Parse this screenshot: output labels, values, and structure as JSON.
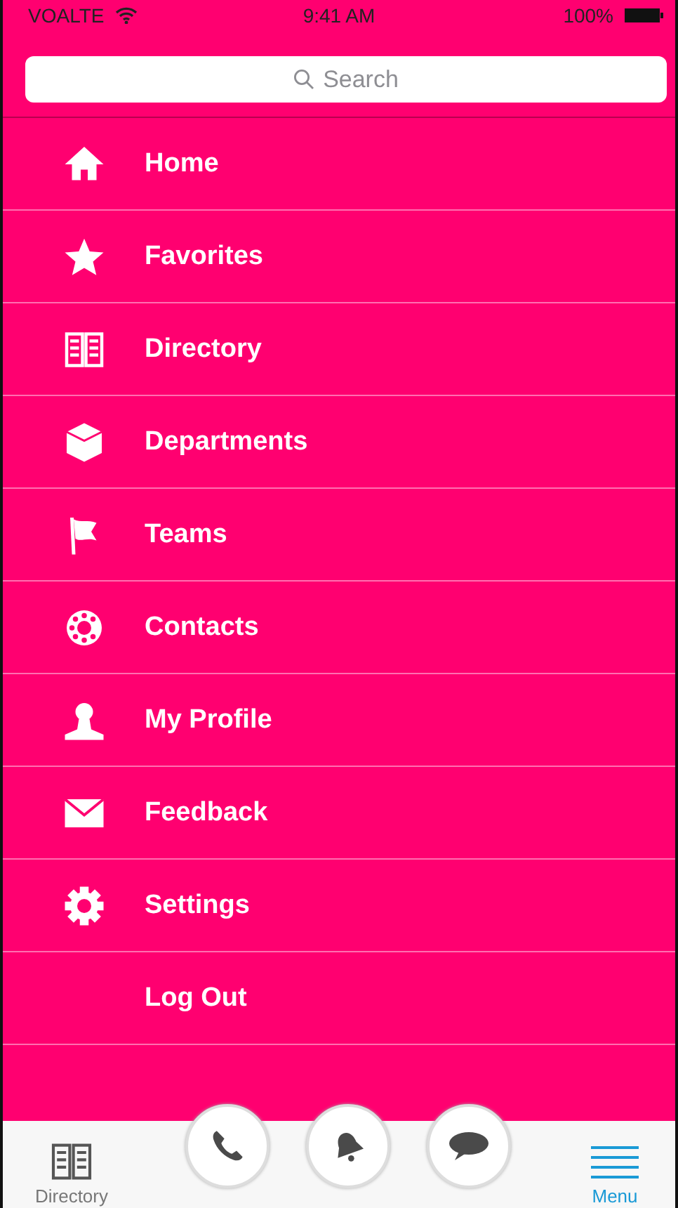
{
  "status_bar": {
    "carrier": "VOALTE",
    "time": "9:41 AM",
    "battery": "100%"
  },
  "search": {
    "placeholder": "Search"
  },
  "menu": [
    {
      "label": "Home"
    },
    {
      "label": "Favorites"
    },
    {
      "label": "Directory"
    },
    {
      "label": "Departments"
    },
    {
      "label": "Teams"
    },
    {
      "label": "Contacts"
    },
    {
      "label": "My Profile"
    },
    {
      "label": "Feedback"
    },
    {
      "label": "Settings"
    },
    {
      "label": "Log Out"
    }
  ],
  "tab_bar": {
    "tabs": [
      {
        "label": "Directory",
        "selected": false
      },
      {
        "label": "Menu",
        "selected": true
      }
    ]
  }
}
